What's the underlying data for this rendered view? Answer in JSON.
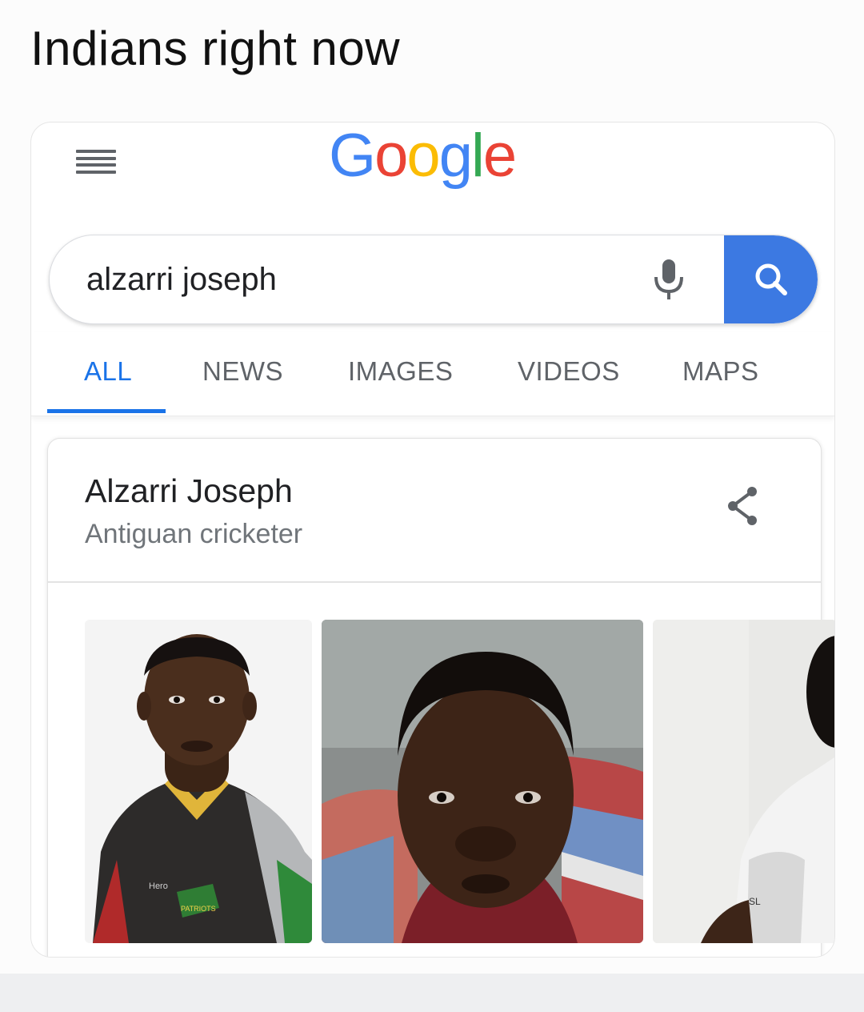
{
  "caption": "Indians right now",
  "header": {
    "logo_letters": [
      {
        "char": "G",
        "color": "#4285f4"
      },
      {
        "char": "o",
        "color": "#ea4335"
      },
      {
        "char": "o",
        "color": "#fbbc05"
      },
      {
        "char": "g",
        "color": "#4285f4"
      },
      {
        "char": "l",
        "color": "#34a853"
      },
      {
        "char": "e",
        "color": "#ea4335"
      }
    ],
    "menu_icon": "hamburger-menu-icon"
  },
  "search": {
    "query": "alzarri joseph",
    "mic_icon": "microphone-icon",
    "search_icon": "magnifier-icon",
    "accent_color": "#3c79e2"
  },
  "tabs": [
    {
      "label": "ALL",
      "active": true
    },
    {
      "label": "NEWS",
      "active": false
    },
    {
      "label": "IMAGES",
      "active": false
    },
    {
      "label": "VIDEOS",
      "active": false
    },
    {
      "label": "MAPS",
      "active": false
    }
  ],
  "knowledge_panel": {
    "title": "Alzarri Joseph",
    "subtitle": "Antiguan cricketer",
    "share_icon": "share-icon",
    "images": [
      {
        "logo": "PATRIOTS",
        "sponsor": "Hero"
      },
      {},
      {
        "sponsor": "SL"
      }
    ]
  }
}
